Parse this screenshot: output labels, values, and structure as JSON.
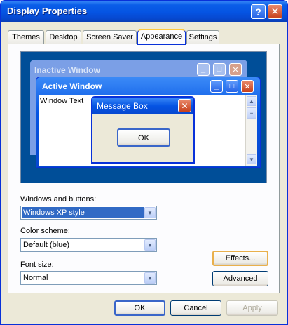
{
  "window": {
    "title": "Display Properties",
    "help_icon": "?",
    "close_icon": "✕"
  },
  "tabs": [
    {
      "label": "Themes"
    },
    {
      "label": "Desktop"
    },
    {
      "label": "Screen Saver"
    },
    {
      "label": "Appearance"
    },
    {
      "label": "Settings"
    }
  ],
  "preview": {
    "inactive_title": "Inactive Window",
    "active_title": "Active Window",
    "window_text": "Window Text",
    "message_box_title": "Message Box",
    "ok_label": "OK"
  },
  "form": {
    "windows_buttons_label": "Windows and buttons:",
    "windows_buttons_value": "Windows XP style",
    "color_scheme_label": "Color scheme:",
    "color_scheme_value": "Default (blue)",
    "font_size_label": "Font size:",
    "font_size_value": "Normal",
    "effects_label": "Effects...",
    "advanced_label": "Advanced"
  },
  "footer": {
    "ok_label": "OK",
    "cancel_label": "Cancel",
    "apply_label": "Apply"
  }
}
